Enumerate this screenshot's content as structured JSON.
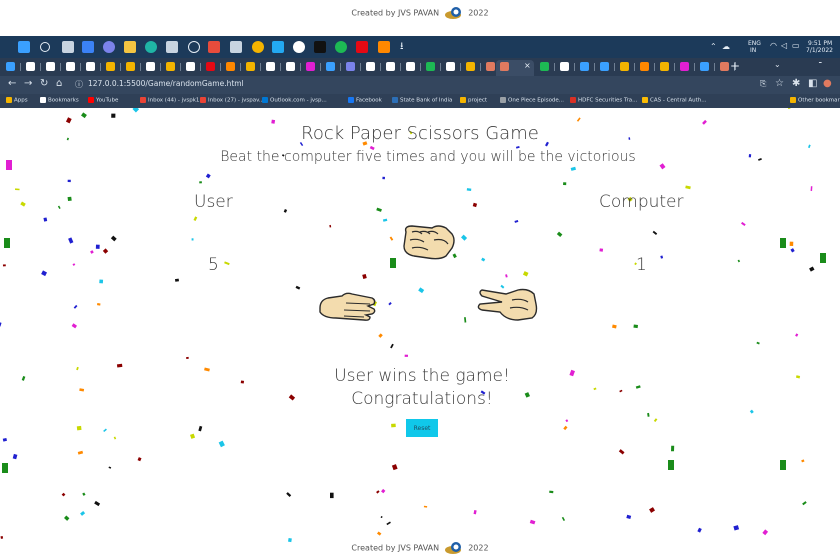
{
  "credit": {
    "text_before": "Created by JVS PAVAN",
    "year": "2022"
  },
  "taskbar": {
    "icons": [
      "windows-start-icon",
      "search-icon",
      "task-view-icon",
      "file-explorer-icon",
      "chat-icon",
      "folder-icon",
      "edge-icon",
      "calculator-icon",
      "clock-icon",
      "mail-icon",
      "photos-icon",
      "chrome-icon",
      "vscode-icon",
      "github-icon",
      "terminal-icon",
      "spotify-icon",
      "netflix-icon",
      "vlc-icon",
      "download-icon"
    ],
    "tray": {
      "language_top": "ENG",
      "language_bottom": "IN",
      "time": "9:51 PM",
      "date": "7/1/2022"
    }
  },
  "browser": {
    "url": "127.0.0.1:5500/Game/randomGame.html",
    "new_tab_glyph": "+",
    "bookmarks": [
      {
        "label": "Apps",
        "color": "#f4b400"
      },
      {
        "label": "Bookmarks",
        "color": "#ffffff"
      },
      {
        "label": "YouTube",
        "color": "#ff0000"
      },
      {
        "label": "Inbox (44) - jvspk1...",
        "color": "#ea4335"
      },
      {
        "label": "Inbox (27) - jvspav...",
        "color": "#ea4335"
      },
      {
        "label": "Outlook.com - jvsp...",
        "color": "#0078d4"
      },
      {
        "label": "Facebook",
        "color": "#1877f2"
      },
      {
        "label": "State Bank of India",
        "color": "#2c6fb7"
      },
      {
        "label": "project",
        "color": "#f4b400"
      },
      {
        "label": "One Piece Episode...",
        "color": "#9aa0a6"
      },
      {
        "label": "HDFC Securities Tra...",
        "color": "#d93025"
      },
      {
        "label": "CAS - Central Auth...",
        "color": "#fbbc04"
      },
      {
        "label": "Other bookmarks",
        "color": "#f4b400"
      }
    ]
  },
  "game": {
    "title": "Rock Paper Scissors Game",
    "subtitle": "Beat the computer five times and you will be the victorious",
    "user_label": "User",
    "computer_label": "Computer",
    "user_score": "5",
    "computer_score": "1",
    "result_line1": "User wins the game!",
    "result_line2": "Congratulations!",
    "reset_label": "Reset",
    "hands": [
      "rock-hand-icon",
      "paper-hand-icon",
      "scissors-hand-icon"
    ]
  },
  "colors": {
    "taskbar": "#1c3a5a",
    "browser_frame": "#34465e",
    "reset_button": "#10c8ea",
    "hand_fill": "#f3dcae",
    "hand_stroke": "#2b2b2b",
    "confetti": [
      "#e11fd2",
      "#1a8c1a",
      "#c8d900",
      "#2020d0",
      "#8b0000",
      "#111111",
      "#1bc5e8",
      "#ff8a00"
    ]
  }
}
